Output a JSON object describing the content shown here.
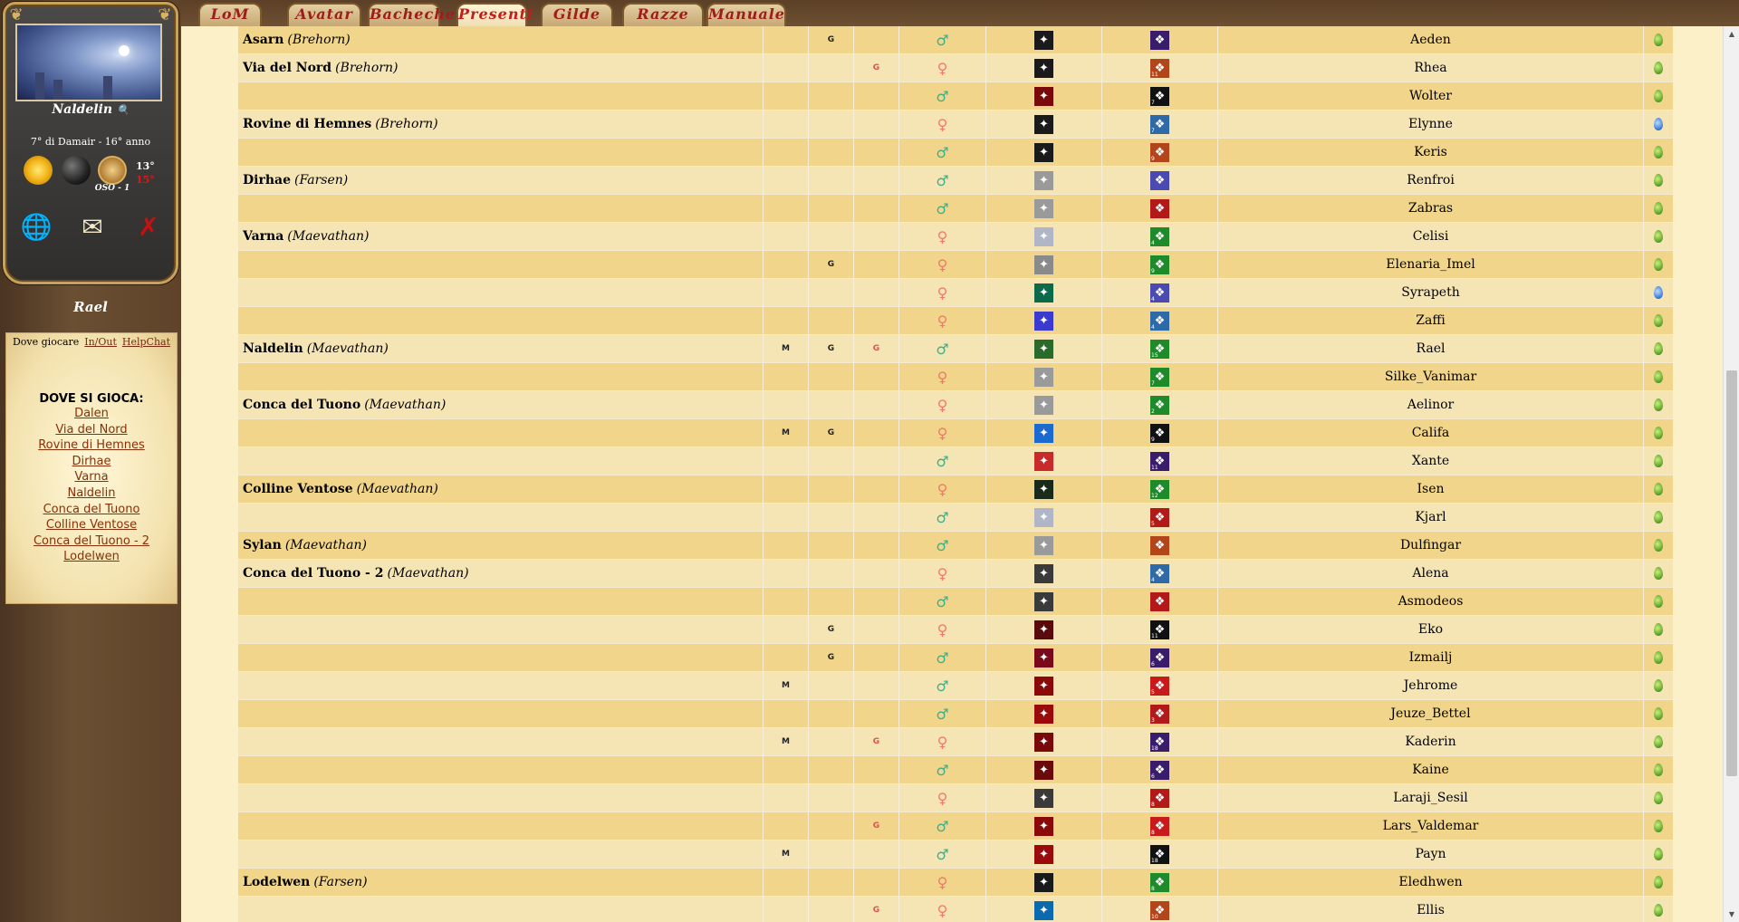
{
  "sidebar": {
    "character": "Naldelin",
    "date": "7° di Damair - 16° anno",
    "wind": "OSO - 1",
    "temp_high": "13°",
    "temp_low": "15°",
    "player": "Rael",
    "panel_tabs": [
      "Dove giocare",
      "In/Out",
      "HelpChat"
    ],
    "panel_heading": "DOVE SI GIOCA:",
    "locations": [
      "Dalen",
      "Via del Nord",
      "Rovine di Hemnes",
      "Dirhae",
      "Varna",
      "Naldelin",
      "Conca del Tuono",
      "Colline Ventose",
      "Conca del Tuono - 2",
      "Lodelwen"
    ]
  },
  "tabs": [
    "LoM",
    "Avatar",
    "Bacheche",
    "Presenti",
    "Gilde",
    "Razze",
    "Manuale"
  ],
  "active_tab": "Presenti",
  "rows": [
    {
      "loc": "Asarn",
      "region": "(Brehorn)",
      "m": "",
      "g1": "G",
      "g2": "",
      "sex": "m",
      "i1": "#1a1a1a",
      "i2": "#3a1d6a",
      "n2": "",
      "name": "Aeden",
      "stat": "green"
    },
    {
      "loc": "Via del Nord",
      "region": "(Brehorn)",
      "m": "",
      "g1": "",
      "g2": "G",
      "sex": "f",
      "i1": "#1a1a1a",
      "i2": "#b2461a",
      "n2": "11",
      "name": "Rhea",
      "stat": "green"
    },
    {
      "loc": "",
      "region": "",
      "m": "",
      "g1": "",
      "g2": "",
      "sex": "m",
      "i1": "#7a0a0a",
      "i2": "#111",
      "n2": "7",
      "name": "Wolter",
      "stat": "green"
    },
    {
      "loc": "Rovine di Hemnes",
      "region": "(Brehorn)",
      "m": "",
      "g1": "",
      "g2": "",
      "sex": "f",
      "i1": "#1a1a1a",
      "i2": "#2f6aa8",
      "n2": "7",
      "name": "Elynne",
      "stat": "blue"
    },
    {
      "loc": "",
      "region": "",
      "m": "",
      "g1": "",
      "g2": "",
      "sex": "m",
      "i1": "#1a1a1a",
      "i2": "#b2461a",
      "n2": "9",
      "name": "Keris",
      "stat": "green"
    },
    {
      "loc": "Dirhae",
      "region": "(Farsen)",
      "m": "",
      "g1": "",
      "g2": "",
      "sex": "m",
      "i1": "#9a9a9a",
      "i2": "#4a4ab0",
      "n2": "",
      "name": "Renfroi",
      "stat": "green"
    },
    {
      "loc": "",
      "region": "",
      "m": "",
      "g1": "",
      "g2": "",
      "sex": "m",
      "i1": "#9a9a9a",
      "i2": "#b21a1a",
      "n2": "",
      "name": "Zabras",
      "stat": "green"
    },
    {
      "loc": "Varna",
      "region": "(Maevathan)",
      "m": "",
      "g1": "",
      "g2": "",
      "sex": "f",
      "i1": "#b0b6c8",
      "i2": "#1e8a2a",
      "n2": "4",
      "name": "Celisi",
      "stat": "green"
    },
    {
      "loc": "",
      "region": "",
      "m": "",
      "g1": "G",
      "g2": "",
      "sex": "f",
      "i1": "#8a8a8a",
      "i2": "#1e8a2a",
      "n2": "9",
      "name": "Elenaria_Imel",
      "stat": "green"
    },
    {
      "loc": "",
      "region": "",
      "m": "",
      "g1": "",
      "g2": "",
      "sex": "f",
      "i1": "#0a6a4a",
      "i2": "#4a4ab0",
      "n2": "4",
      "name": "Syrapeth",
      "stat": "blue"
    },
    {
      "loc": "",
      "region": "",
      "m": "",
      "g1": "",
      "g2": "",
      "sex": "f",
      "i1": "#3a3ad0",
      "i2": "#2f6aa8",
      "n2": "4",
      "name": "Zaffi",
      "stat": "green"
    },
    {
      "loc": "Naldelin",
      "region": "(Maevathan)",
      "m": "M",
      "g1": "G",
      "g2": "G",
      "sex": "m",
      "i1": "#2a6a2a",
      "i2": "#1e8a2a",
      "n2": "15",
      "name": "Rael",
      "stat": "green"
    },
    {
      "loc": "",
      "region": "",
      "m": "",
      "g1": "",
      "g2": "",
      "sex": "f",
      "i1": "#9a9a9a",
      "i2": "#1e8a2a",
      "n2": "7",
      "name": "Silke_Vanimar",
      "stat": "green"
    },
    {
      "loc": "Conca del Tuono",
      "region": "(Maevathan)",
      "m": "",
      "g1": "",
      "g2": "",
      "sex": "f",
      "i1": "#9a9a9a",
      "i2": "#1e8a2a",
      "n2": "2",
      "name": "Aelinor",
      "stat": "green"
    },
    {
      "loc": "",
      "region": "",
      "m": "M",
      "g1": "G",
      "g2": "",
      "sex": "f",
      "i1": "#1a6ad0",
      "i2": "#111",
      "n2": "9",
      "name": "Califa",
      "stat": "green"
    },
    {
      "loc": "",
      "region": "",
      "m": "",
      "g1": "",
      "g2": "",
      "sex": "m",
      "i1": "#c82a2a",
      "i2": "#3a1d6a",
      "n2": "11",
      "name": "Xante",
      "stat": "green"
    },
    {
      "loc": "Colline Ventose",
      "region": "(Maevathan)",
      "m": "",
      "g1": "",
      "g2": "",
      "sex": "f",
      "i1": "#1a2a1a",
      "i2": "#1e8a2a",
      "n2": "12",
      "name": "Isen",
      "stat": "green"
    },
    {
      "loc": "",
      "region": "",
      "m": "",
      "g1": "",
      "g2": "",
      "sex": "m",
      "i1": "#b0b6c8",
      "i2": "#b21a1a",
      "n2": "5",
      "name": "Kjarl",
      "stat": "green"
    },
    {
      "loc": "Sylan",
      "region": "(Maevathan)",
      "m": "",
      "g1": "",
      "g2": "",
      "sex": "m",
      "i1": "#9a9a9a",
      "i2": "#b2461a",
      "n2": "",
      "name": "Dulfingar",
      "stat": "green"
    },
    {
      "loc": "Conca del Tuono - 2",
      "region": "(Maevathan)",
      "m": "",
      "g1": "",
      "g2": "",
      "sex": "f",
      "i1": "#3a3a3a",
      "i2": "#2f6aa8",
      "n2": "4",
      "name": "Alena",
      "stat": "green"
    },
    {
      "loc": "",
      "region": "",
      "m": "",
      "g1": "",
      "g2": "",
      "sex": "m",
      "i1": "#3a3a3a",
      "i2": "#b21a1a",
      "n2": "",
      "name": "Asmodeos",
      "stat": "green"
    },
    {
      "loc": "",
      "region": "",
      "m": "",
      "g1": "G",
      "g2": "",
      "sex": "f",
      "i1": "#5a0a0a",
      "i2": "#111",
      "n2": "11",
      "name": "Eko",
      "stat": "green"
    },
    {
      "loc": "",
      "region": "",
      "m": "",
      "g1": "G",
      "g2": "",
      "sex": "m",
      "i1": "#7a0a1a",
      "i2": "#3a1d6a",
      "n2": "6",
      "name": "Izmailj",
      "stat": "green"
    },
    {
      "loc": "",
      "region": "",
      "m": "M",
      "g1": "",
      "g2": "",
      "sex": "m",
      "i1": "#8a0a0a",
      "i2": "#c81a1a",
      "n2": "5",
      "name": "Jehrome",
      "stat": "green"
    },
    {
      "loc": "",
      "region": "",
      "m": "",
      "g1": "",
      "g2": "",
      "sex": "m",
      "i1": "#9a0a0a",
      "i2": "#b21a1a",
      "n2": "3",
      "name": "Jeuze_Bettel",
      "stat": "green"
    },
    {
      "loc": "",
      "region": "",
      "m": "M",
      "g1": "",
      "g2": "G",
      "sex": "f",
      "i1": "#7a0a0a",
      "i2": "#3a1d6a",
      "n2": "18",
      "name": "Kaderin",
      "stat": "green"
    },
    {
      "loc": "",
      "region": "",
      "m": "",
      "g1": "",
      "g2": "",
      "sex": "m",
      "i1": "#6a0a0a",
      "i2": "#3a1d6a",
      "n2": "6",
      "name": "Kaine",
      "stat": "green"
    },
    {
      "loc": "",
      "region": "",
      "m": "",
      "g1": "",
      "g2": "",
      "sex": "f",
      "i1": "#3a3a3a",
      "i2": "#b21a1a",
      "n2": "8",
      "name": "Laraji_Sesil",
      "stat": "green"
    },
    {
      "loc": "",
      "region": "",
      "m": "",
      "g1": "",
      "g2": "G",
      "sex": "m",
      "i1": "#8a0a0a",
      "i2": "#c81a1a",
      "n2": "8",
      "name": "Lars_Valdemar",
      "stat": "green"
    },
    {
      "loc": "",
      "region": "",
      "m": "M",
      "g1": "",
      "g2": "",
      "sex": "m",
      "i1": "#9a0a0a",
      "i2": "#111",
      "n2": "18",
      "name": "Payn",
      "stat": "green"
    },
    {
      "loc": "Lodelwen",
      "region": "(Farsen)",
      "m": "",
      "g1": "",
      "g2": "",
      "sex": "f",
      "i1": "#1a1a1a",
      "i2": "#1e8a2a",
      "n2": "8",
      "name": "Eledhwen",
      "stat": "green"
    },
    {
      "loc": "",
      "region": "",
      "m": "",
      "g1": "",
      "g2": "G",
      "sex": "f",
      "i1": "#0a6ab0",
      "i2": "#b2461a",
      "n2": "10",
      "name": "Ellis",
      "stat": "green"
    }
  ]
}
